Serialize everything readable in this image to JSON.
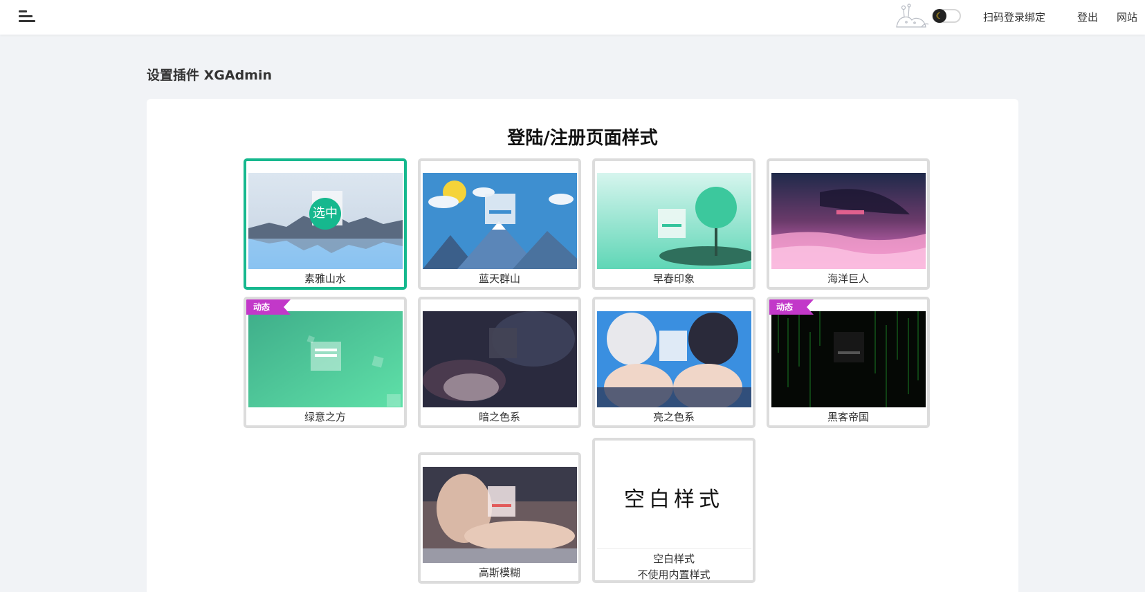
{
  "header": {
    "links": {
      "qr_bind": "扫码登录绑定",
      "logout": "登出",
      "site": "网站"
    }
  },
  "page": {
    "title": "设置插件 XGAdmin",
    "section_title": "登陆/注册页面样式"
  },
  "styles": [
    {
      "label": "素雅山水",
      "selected": true,
      "badge": "选中"
    },
    {
      "label": "蓝天群山"
    },
    {
      "label": "早春印象"
    },
    {
      "label": "海洋巨人"
    },
    {
      "label": "绿意之方",
      "dynamic_tag": "动态"
    },
    {
      "label": "暗之色系"
    },
    {
      "label": "亮之色系"
    },
    {
      "label": "黑客帝国",
      "dynamic_tag": "动态"
    },
    {
      "label": "高斯模糊"
    },
    {
      "label": "空白样式",
      "sublabel": "不使用内置样式",
      "art_text": "空白样式"
    }
  ],
  "colors": {
    "accent": "#16b88e",
    "ribbon": "#c238c9"
  }
}
